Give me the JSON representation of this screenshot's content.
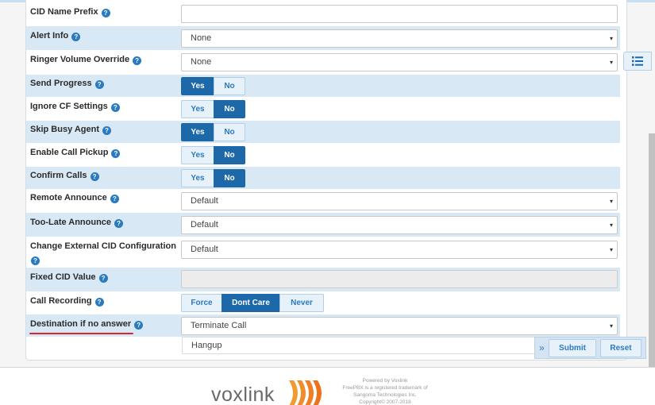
{
  "form": {
    "fields": [
      {
        "label": "CID Name Prefix",
        "type": "text",
        "value": ""
      },
      {
        "label": "Alert Info",
        "type": "select",
        "value": "None"
      },
      {
        "label": "Ringer Volume Override",
        "type": "select",
        "value": "None"
      },
      {
        "label": "Send Progress",
        "type": "toggle",
        "options": [
          "Yes",
          "No"
        ],
        "selected": "Yes"
      },
      {
        "label": "Ignore CF Settings",
        "type": "toggle",
        "options": [
          "Yes",
          "No"
        ],
        "selected": "No"
      },
      {
        "label": "Skip Busy Agent",
        "type": "toggle",
        "options": [
          "Yes",
          "No"
        ],
        "selected": "Yes"
      },
      {
        "label": "Enable Call Pickup",
        "type": "toggle",
        "options": [
          "Yes",
          "No"
        ],
        "selected": "No"
      },
      {
        "label": "Confirm Calls",
        "type": "toggle",
        "options": [
          "Yes",
          "No"
        ],
        "selected": "No"
      },
      {
        "label": "Remote Announce",
        "type": "select",
        "value": "Default"
      },
      {
        "label": "Too-Late Announce",
        "type": "select",
        "value": "Default"
      },
      {
        "label": "Change External CID Configuration",
        "type": "select",
        "value": "Default"
      },
      {
        "label": "Fixed CID Value",
        "type": "text-disabled",
        "value": ""
      },
      {
        "label": "Call Recording",
        "type": "toggle",
        "options": [
          "Force",
          "Dont Care",
          "Never"
        ],
        "selected": "Dont Care"
      },
      {
        "label": "Destination if no answer",
        "type": "select",
        "value": "Terminate Call"
      }
    ],
    "destination_sub_value": "Hangup",
    "help_glyph": "?",
    "caret_glyph": "▾"
  },
  "actions": {
    "chevron": "»",
    "submit_label": "Submit",
    "reset_label": "Reset"
  },
  "footer": {
    "logo_text": "voxlink",
    "lines": [
      "Powered by Voxlink",
      "FreePBX is a registered trademark of",
      "Sangoma Technologies Inc.",
      "Copyright© 2007-2018"
    ]
  },
  "colors": {
    "accent": "#1d68a8",
    "row_highlight": "#d8e8f5",
    "annotation_underline": "#d9262a",
    "logo_orange": "#f28c28"
  }
}
